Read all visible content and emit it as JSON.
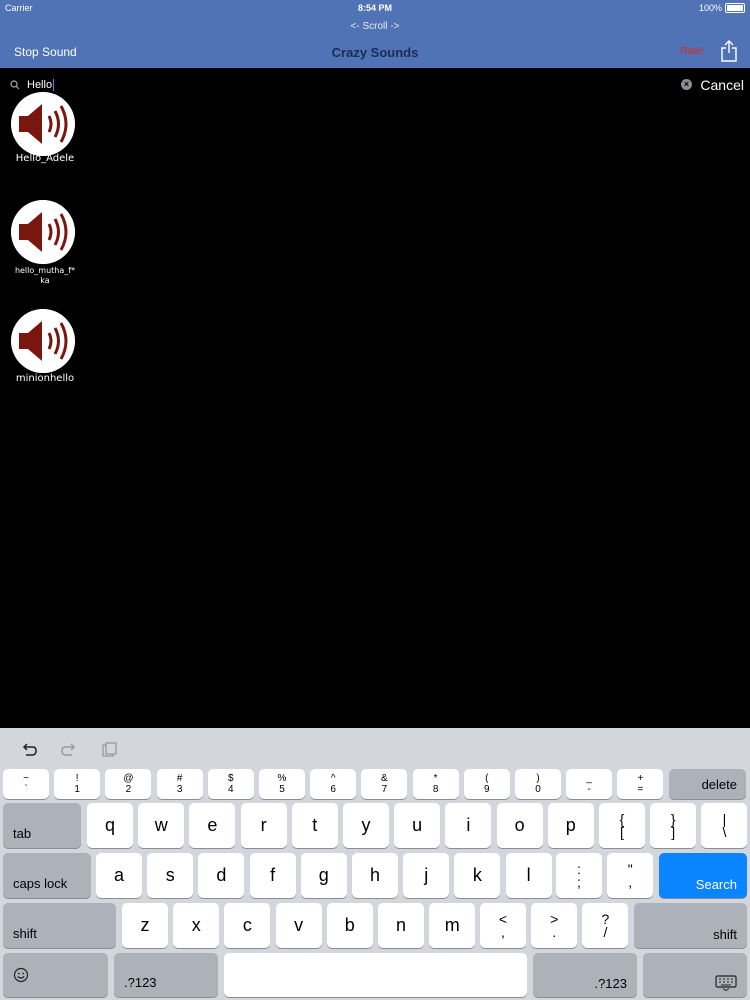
{
  "status": {
    "carrier": "Carrier",
    "time": "8:54 PM",
    "battery": "100%"
  },
  "header": {
    "scroll_hint": "<- Scroll ->",
    "stop_sound": "Stop Sound",
    "title": "Crazy Sounds",
    "rate": "Rate!",
    "share_icon": "share-icon"
  },
  "search": {
    "value": "Hello",
    "cancel": "Cancel"
  },
  "results": [
    {
      "label": "Hello_Adele"
    },
    {
      "label": "hello_mutha_f*",
      "label2": "ka"
    },
    {
      "label": "minionhello"
    }
  ],
  "keyboard": {
    "toolbar": {
      "undo": "undo-icon",
      "redo": "redo-icon",
      "paste": "paste-icon"
    },
    "numrow": [
      [
        "~",
        "`"
      ],
      [
        "!",
        "1"
      ],
      [
        "@",
        "2"
      ],
      [
        "#",
        "3"
      ],
      [
        "$",
        "4"
      ],
      [
        "%",
        "5"
      ],
      [
        "^",
        "6"
      ],
      [
        "&",
        "7"
      ],
      [
        "*",
        "8"
      ],
      [
        "(",
        "9"
      ],
      [
        ")",
        "0"
      ],
      [
        "_",
        "-"
      ],
      [
        "+",
        "="
      ]
    ],
    "delete": "delete",
    "tab": "tab",
    "row1": [
      "q",
      "w",
      "e",
      "r",
      "t",
      "y",
      "u",
      "i",
      "o",
      "p"
    ],
    "row1_sym": [
      [
        "{",
        "["
      ],
      [
        "}",
        "]"
      ],
      [
        "|",
        "\\"
      ]
    ],
    "caps": "caps lock",
    "row2": [
      "a",
      "s",
      "d",
      "f",
      "g",
      "h",
      "j",
      "k",
      "l"
    ],
    "row2_sym": [
      [
        ":",
        ";"
      ],
      [
        "\"",
        ","
      ]
    ],
    "search": "Search",
    "shift": "shift",
    "row3": [
      "z",
      "x",
      "c",
      "v",
      "b",
      "n",
      "m"
    ],
    "row3_sym": [
      [
        "<",
        ","
      ],
      [
        ">",
        "."
      ],
      [
        "?",
        "/"
      ]
    ],
    "emoji": "emoji-icon",
    "num_switch": ".?123",
    "hide_kb": "keyboard-hide-icon"
  },
  "colors": {
    "header": "#4f73b5",
    "speaker": "#7a1510",
    "search_key": "#0a84ff"
  }
}
